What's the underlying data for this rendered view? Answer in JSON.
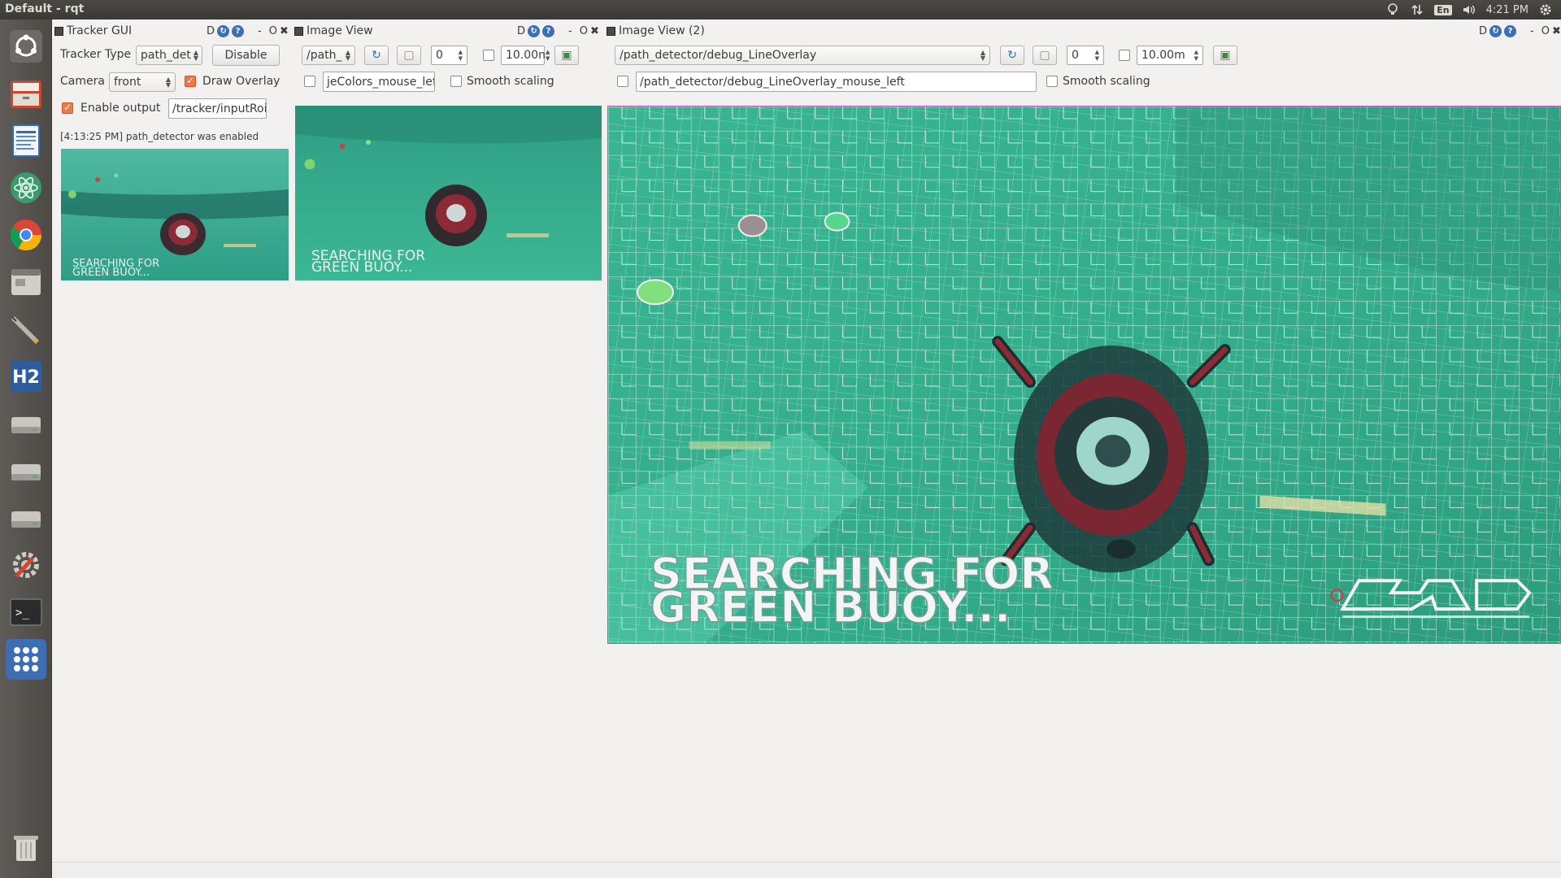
{
  "window_title": "Default - rqt",
  "system": {
    "keyboard": "En",
    "clock": "4:21 PM"
  },
  "launcher": {
    "items": [
      "ubuntu-dash-icon",
      "files-icon",
      "writer-icon",
      "atom-icon",
      "chrome-icon",
      "window-icon",
      "pen-tool-icon",
      "h2-icon",
      "disk-icon",
      "disk-icon",
      "disk-icon",
      "settings-icon",
      "terminal-icon",
      "apps-grid-icon",
      "trash-icon"
    ]
  },
  "tracker": {
    "title": "Tracker GUI",
    "ctrl_letters": "D",
    "ctrl_dash": "-",
    "ctrl_o": "O",
    "ctrl_x": "✖",
    "tracker_type_label": "Tracker Type",
    "tracker_type_value": "path_det",
    "disable_label": "Disable",
    "camera_label": "Camera",
    "camera_value": "front",
    "draw_overlay_label": "Draw Overlay",
    "enable_output_label": "Enable output",
    "output_topic": "/tracker/inputRoi",
    "log_message": "[4:13:25 PM] path_detector was enabled"
  },
  "image_view": {
    "title": "Image View",
    "topic": "/path_",
    "spin_value": "0",
    "duration": "10.00n",
    "mouse_topic": "jeColors_mouse_left",
    "smooth_label": "Smooth scaling"
  },
  "image_view_2": {
    "title": "Image View (2)",
    "topic": "/path_detector/debug_LineOverlay",
    "spin_value": "0",
    "duration": "10.00m",
    "mouse_topic": "/path_detector/debug_LineOverlay_mouse_left",
    "smooth_label": "Smooth scaling"
  },
  "overlay": {
    "line1": "SEARCHING FOR",
    "line2": "GREEN BUOY..."
  },
  "colors": {
    "water": "#2fae8a",
    "water_dark": "#1f8f73",
    "accent_orange": "#f07746",
    "robot_red": "#8c2a35"
  }
}
